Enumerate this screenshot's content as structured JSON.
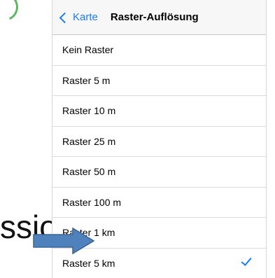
{
  "slide": {
    "overlay_text": "ssio"
  },
  "navbar": {
    "back_label": "Karte",
    "title": "Raster-Auflösung"
  },
  "options": [
    {
      "label": "Kein Raster",
      "selected": false
    },
    {
      "label": "Raster 5 m",
      "selected": false
    },
    {
      "label": "Raster 10 m",
      "selected": false
    },
    {
      "label": "Raster 25 m",
      "selected": false
    },
    {
      "label": "Raster 50 m",
      "selected": false
    },
    {
      "label": "Raster 100 m",
      "selected": false
    },
    {
      "label": "Raster 1 km",
      "selected": false
    },
    {
      "label": "Raster 5 km",
      "selected": true
    }
  ],
  "colors": {
    "accent": "#1a7cf5",
    "arrow_fill": "#4f81bd",
    "arrow_stroke": "#3a6494"
  },
  "icons": {
    "back": "chevron-left-icon",
    "check": "checkmark-icon",
    "pointer": "arrow-right-icon"
  }
}
